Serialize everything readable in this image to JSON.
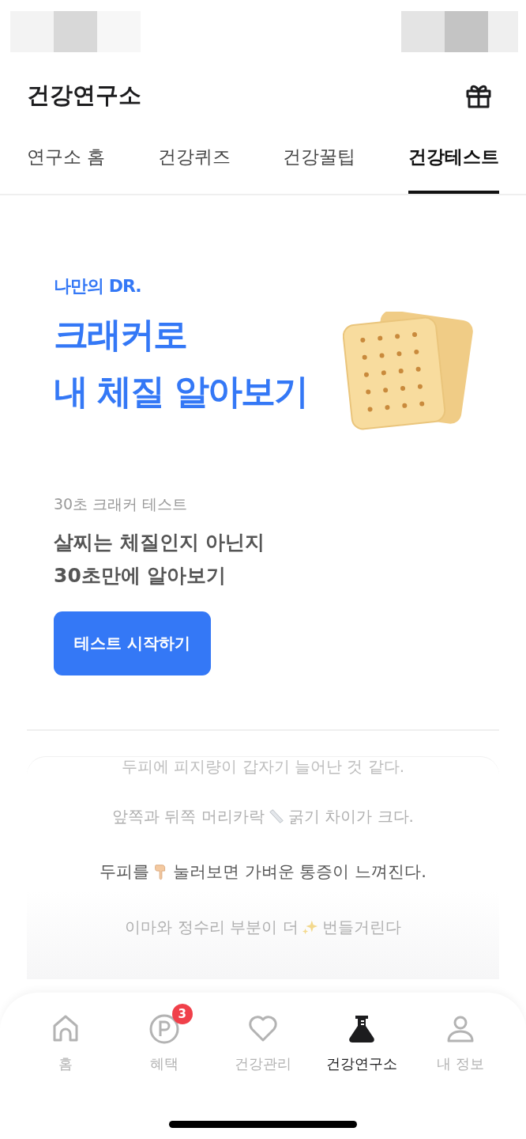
{
  "header": {
    "title": "건강연구소"
  },
  "tabs": [
    {
      "label": "연구소 홈",
      "selected": false
    },
    {
      "label": "건강퀴즈",
      "selected": false
    },
    {
      "label": "건강꿀팁",
      "selected": false
    },
    {
      "label": "건강테스트",
      "selected": true
    }
  ],
  "banner": {
    "brand": "나만의 DR.",
    "headline": [
      "크래커로",
      "내 체질 알아보기"
    ]
  },
  "test": {
    "caption": "30초 크래커 테스트",
    "title": [
      "살찌는 체질인지 아닌지",
      "30초만에 알아보기"
    ],
    "button": "테스트 시작하기"
  },
  "statements": [
    {
      "before": "두피에 피지량이 갑자기 늘어난 것 같다.",
      "kind": "plain",
      "selected": false
    },
    {
      "before": "앞쪽과 뒤쪽 머리카락",
      "kind": "ruler",
      "after": "굵기 차이가 크다.",
      "selected": false
    },
    {
      "before": "두피를",
      "kind": "pointing",
      "after": "눌러보면 가벼운 통증이 느껴진다.",
      "selected": true
    },
    {
      "before": "이마와 정수리 부분이 더",
      "kind": "sparkles",
      "after": "번들거린다",
      "selected": false
    }
  ],
  "bottom_nav": [
    {
      "label": "홈",
      "kind": "home",
      "selected": false
    },
    {
      "label": "혜택",
      "kind": "points",
      "selected": false,
      "badge": "3"
    },
    {
      "label": "건강관리",
      "kind": "heart",
      "selected": false
    },
    {
      "label": "건강연구소",
      "kind": "flask",
      "selected": true
    },
    {
      "label": "내 정보",
      "kind": "person",
      "selected": false
    }
  ]
}
